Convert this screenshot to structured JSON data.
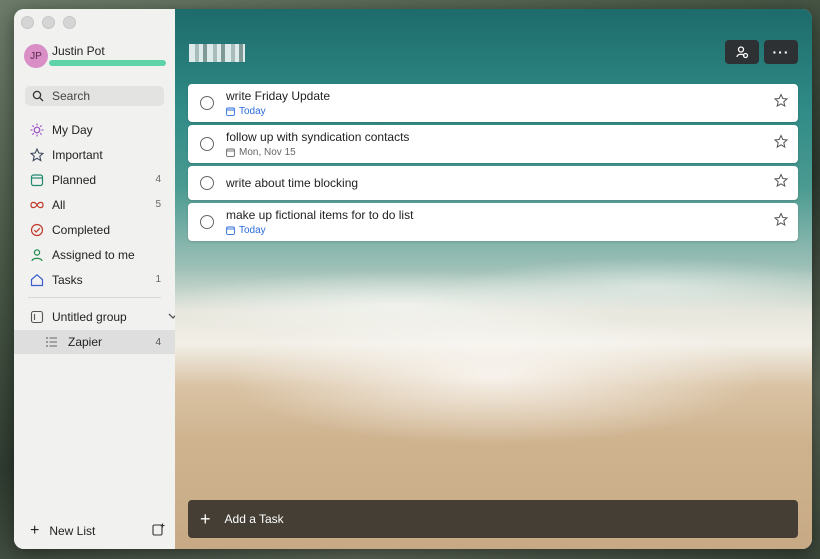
{
  "window": {
    "traffic_lights": [
      "close",
      "minimize",
      "zoom"
    ]
  },
  "profile": {
    "initials": "JP",
    "name": "Justin Pot"
  },
  "search": {
    "label": "Search"
  },
  "nav": [
    {
      "label": "My Day",
      "icon": "sun-icon",
      "count": ""
    },
    {
      "label": "Important",
      "icon": "star-icon",
      "count": ""
    },
    {
      "label": "Planned",
      "icon": "calendar-icon",
      "count": "4"
    },
    {
      "label": "All",
      "icon": "infinity-icon",
      "count": "5"
    },
    {
      "label": "Completed",
      "icon": "check-circle-icon",
      "count": ""
    },
    {
      "label": "Assigned to me",
      "icon": "person-icon",
      "count": ""
    },
    {
      "label": "Tasks",
      "icon": "home-icon",
      "count": "1"
    }
  ],
  "group": {
    "label": "Untitled group"
  },
  "lists": [
    {
      "label": "Zapier",
      "count": "4"
    }
  ],
  "footer": {
    "new_list": "New List"
  },
  "tasks": [
    {
      "title": "write Friday Update",
      "due": "Today",
      "due_type": "today"
    },
    {
      "title": "follow up with syndication contacts",
      "due": "Mon, Nov 15",
      "due_type": "date"
    },
    {
      "title": "write about time blocking",
      "due": "",
      "due_type": "none"
    },
    {
      "title": "make up fictional items for to do list",
      "due": "Today",
      "due_type": "today"
    }
  ],
  "add_task": {
    "label": "Add a Task"
  },
  "colors": {
    "accent_today": "#2b6ddb",
    "avatar": "#d98ec6",
    "add_bar": "#3a342e"
  }
}
